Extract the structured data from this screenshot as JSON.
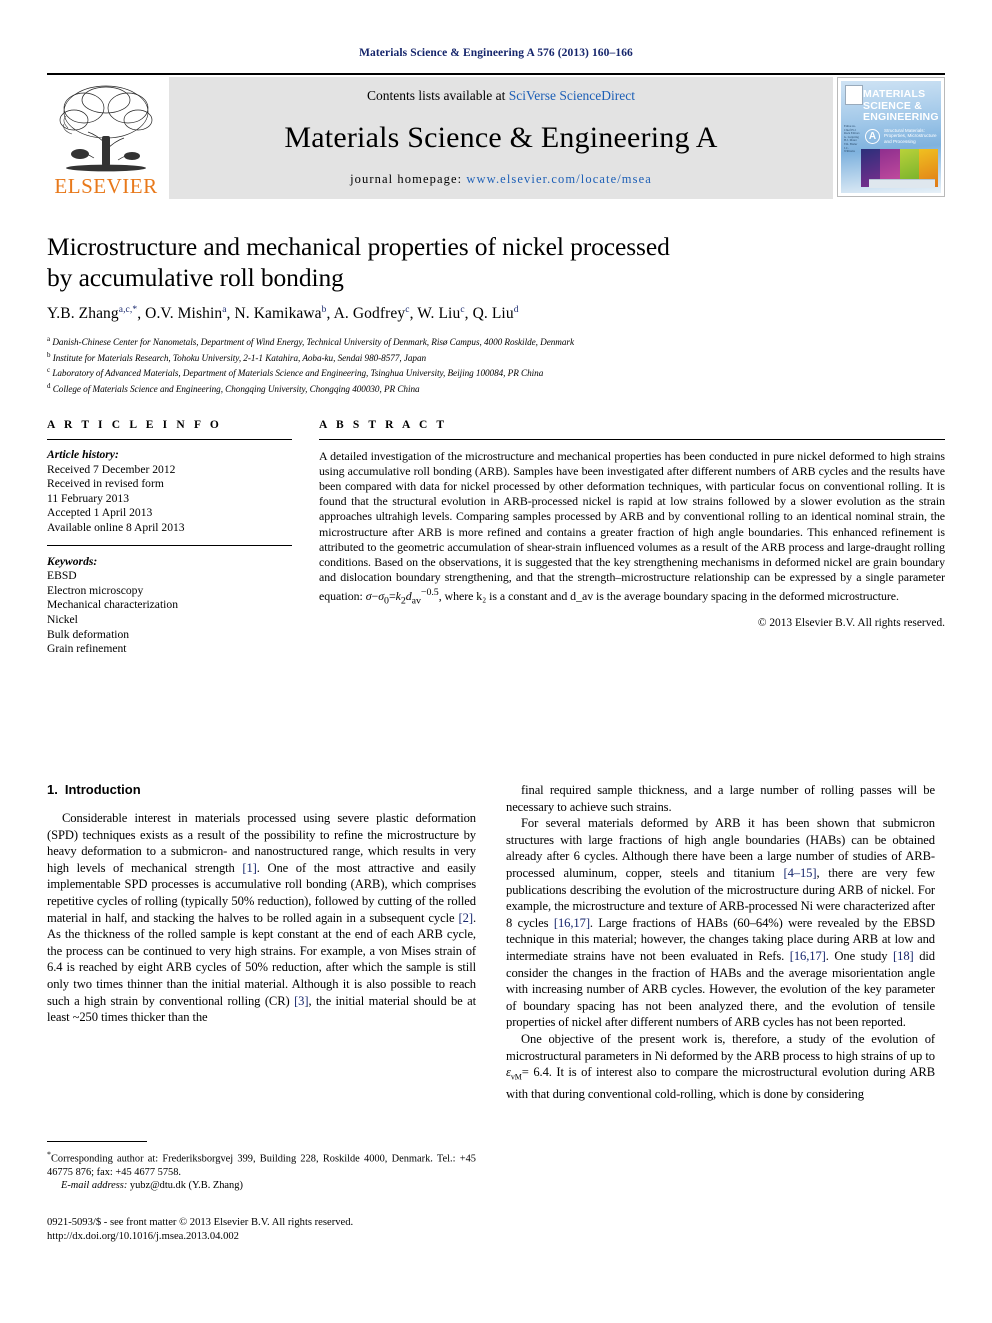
{
  "running_head": "Materials Science & Engineering A 576 (2013) 160–166",
  "masthead": {
    "publisher_name": "ELSEVIER",
    "contents_prefix": "Contents lists available at ",
    "contents_link": "SciVerse ScienceDirect",
    "journal_title": "Materials Science & Engineering A",
    "homepage_prefix": "journal homepage: ",
    "homepage_url": "www.elsevier.com/locate/msea",
    "cover": {
      "title_line1": "MATERIALS",
      "title_line2": "SCIENCE &",
      "title_line3": "ENGINEERING",
      "series_letter": "A",
      "subtitle": "Structural Materials: Properties, Microstructure and Processing",
      "left_column_text": "Editor-in-Chief\nH.J. Rack\n\nEditors\nG. Lutjering\nH.J. Maier\nT.R. Bieler\nJ.C. Williams",
      "bottom_caption": "Available online at\nwww.sciencedirect.com"
    }
  },
  "article": {
    "title_line1": "Microstructure and mechanical properties of nickel processed",
    "title_line2": "by accumulative roll bonding",
    "authors": [
      {
        "name": "Y.B. Zhang",
        "sup": "a,c,*"
      },
      {
        "name": "O.V. Mishin",
        "sup": "a"
      },
      {
        "name": "N. Kamikawa",
        "sup": "b"
      },
      {
        "name": "A. Godfrey",
        "sup": "c"
      },
      {
        "name": "W. Liu",
        "sup": "c"
      },
      {
        "name": "Q. Liu",
        "sup": "d"
      }
    ],
    "affiliations": [
      {
        "sup": "a",
        "text": "Danish-Chinese Center for Nanometals, Department of Wind Energy, Technical University of Denmark, Risø Campus, 4000 Roskilde, Denmark"
      },
      {
        "sup": "b",
        "text": "Institute for Materials Research, Tohoku University, 2-1-1 Katahira, Aoba-ku, Sendai 980-8577, Japan"
      },
      {
        "sup": "c",
        "text": "Laboratory of Advanced Materials, Department of Materials Science and Engineering, Tsinghua University, Beijing 100084, PR China"
      },
      {
        "sup": "d",
        "text": "College of Materials Science and Engineering, Chongqing University, Chongqing 400030, PR China"
      }
    ]
  },
  "article_info": {
    "heading": "A R T I C L E   I N F O",
    "history_label": "Article history:",
    "history": [
      "Received 7 December 2012",
      "Received in revised form",
      "11 February 2013",
      "Accepted 1 April 2013",
      "Available online 8 April 2013"
    ],
    "keywords_label": "Keywords:",
    "keywords": [
      "EBSD",
      "Electron microscopy",
      "Mechanical characterization",
      "Nickel",
      "Bulk deformation",
      "Grain refinement"
    ]
  },
  "abstract": {
    "heading": "A B S T R A C T",
    "text_part1": "A detailed investigation of the microstructure and mechanical properties has been conducted in pure nickel deformed to high strains using accumulative roll bonding (ARB). Samples have been investigated after different numbers of ARB cycles and the results have been compared with data for nickel processed by other deformation techniques, with particular focus on conventional rolling. It is found that the structural evolution in ARB-processed nickel is rapid at low strains followed by a slower evolution as the strain approaches ultrahigh levels. Comparing samples processed by ARB and by conventional rolling to an identical nominal strain, the microstructure after ARB is more refined and contains a greater fraction of high angle boundaries. This enhanced refinement is attributed to the geometric accumulation of shear-strain influenced volumes as a result of the ARB process and large-draught rolling conditions. Based on the observations, it is suggested that the key strengthening mechanisms in deformed nickel are grain boundary and dislocation boundary strengthening, and that the strength–microstructure relationship can be expressed by a single parameter equation: ",
    "equation": "σ−σ₀=k₂d_av^−0.5",
    "text_part2": ", where k₂ is a constant and d_av is the average boundary spacing in the deformed microstructure.",
    "copyright": "© 2013 Elsevier B.V. All rights reserved."
  },
  "introduction": {
    "section_number": "1.",
    "section_title": "Introduction",
    "left_paragraph": "Considerable interest in materials processed using severe plastic deformation (SPD) techniques exists as a result of the possibility to refine the microstructure by heavy deformation to a submicron- and nanostructured range, which results in very high levels of mechanical strength [1]. One of the most attractive and easily implementable SPD processes is accumulative roll bonding (ARB), which comprises repetitive cycles of rolling (typically 50% reduction), followed by cutting of the rolled material in half, and stacking the halves to be rolled again in a subsequent cycle [2]. As the thickness of the rolled sample is kept constant at the end of each ARB cycle, the process can be continued to very high strains. For example, a von Mises strain of 6.4 is reached by eight ARB cycles of 50% reduction, after which the sample is still only two times thinner than the initial material. Although it is also possible to reach such a high strain by conventional rolling (CR) [3], the initial material should be at least ~250 times thicker than the",
    "right_paragraph_1": "final required sample thickness, and a large number of rolling passes will be necessary to achieve such strains.",
    "right_paragraph_2": "For several materials deformed by ARB it has been shown that submicron structures with large fractions of high angle boundaries (HABs) can be obtained already after 6 cycles. Although there have been a large number of studies of ARB-processed aluminum, copper, steels and titanium [4–15], there are very few publications describing the evolution of the microstructure during ARB of nickel. For example, the microstructure and texture of ARB-processed Ni were characterized after 8 cycles [16,17]. Large fractions of HABs (60–64%) were revealed by the EBSD technique in this material; however, the changes taking place during ARB at low and intermediate strains have not been evaluated in Refs. [16,17]. One study [18] did consider the changes in the fraction of HABs and the average misorientation angle with increasing number of ARB cycles. However, the evolution of the key parameter of boundary spacing has not been analyzed there, and the evolution of tensile properties of nickel after different numbers of ARB cycles has not been reported.",
    "right_paragraph_3": "One objective of the present work is, therefore, a study of the evolution of microstructural parameters in Ni deformed by the ARB process to high strains of up to εvM= 6.4. It is of interest also to compare the microstructural evolution during ARB with that during conventional cold-rolling, which is done by considering"
  },
  "footnote": {
    "star": "*",
    "text": "Corresponding author at: Frederiksborgvej 399, Building 228, Roskilde 4000, Denmark. Tel.: +45 46775 876; fax: +45 4677 5758.",
    "email_label": "E-mail address:",
    "email": "yubz@dtu.dk",
    "email_owner": "(Y.B. Zhang)"
  },
  "imprint": {
    "line1": "0921-5093/$ - see front matter © 2013 Elsevier B.V. All rights reserved.",
    "doi": "http://dx.doi.org/10.1016/j.msea.2013.04.002"
  },
  "colors": {
    "link_blue": "#1d5fb6",
    "citation_blue": "#15256b",
    "elsevier_orange": "#E8791B",
    "banner_gray": "#e3e3e3"
  }
}
